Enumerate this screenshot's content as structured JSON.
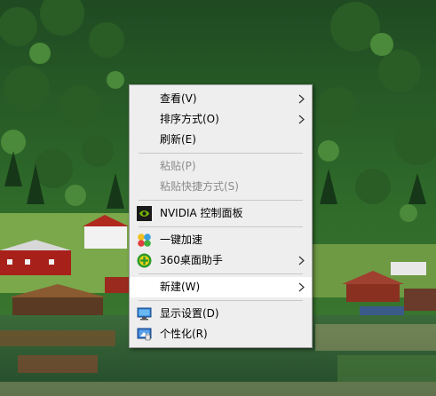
{
  "context_menu": {
    "items": [
      {
        "label": "查看(V)",
        "has_submenu": true
      },
      {
        "label": "排序方式(O)",
        "has_submenu": true
      },
      {
        "label": "刷新(E)"
      },
      {
        "label": "粘贴(P)",
        "disabled": true
      },
      {
        "label": "粘贴快捷方式(S)",
        "disabled": true
      },
      {
        "label": "NVIDIA 控制面板",
        "icon": "nvidia-icon"
      },
      {
        "label": "一键加速",
        "icon": "speedup-icon"
      },
      {
        "label": "360桌面助手",
        "icon": "360-assistant-icon",
        "has_submenu": true
      },
      {
        "label": "新建(W)",
        "has_submenu": true,
        "hovered": true
      },
      {
        "label": "显示设置(D)",
        "icon": "display-settings-icon"
      },
      {
        "label": "个性化(R)",
        "icon": "personalize-icon"
      }
    ]
  },
  "colors": {
    "menu_background": "#eeeeee",
    "menu_hover": "#ffffff",
    "menu_border": "#a0a0a0",
    "disabled_text": "#8c8c8c"
  }
}
